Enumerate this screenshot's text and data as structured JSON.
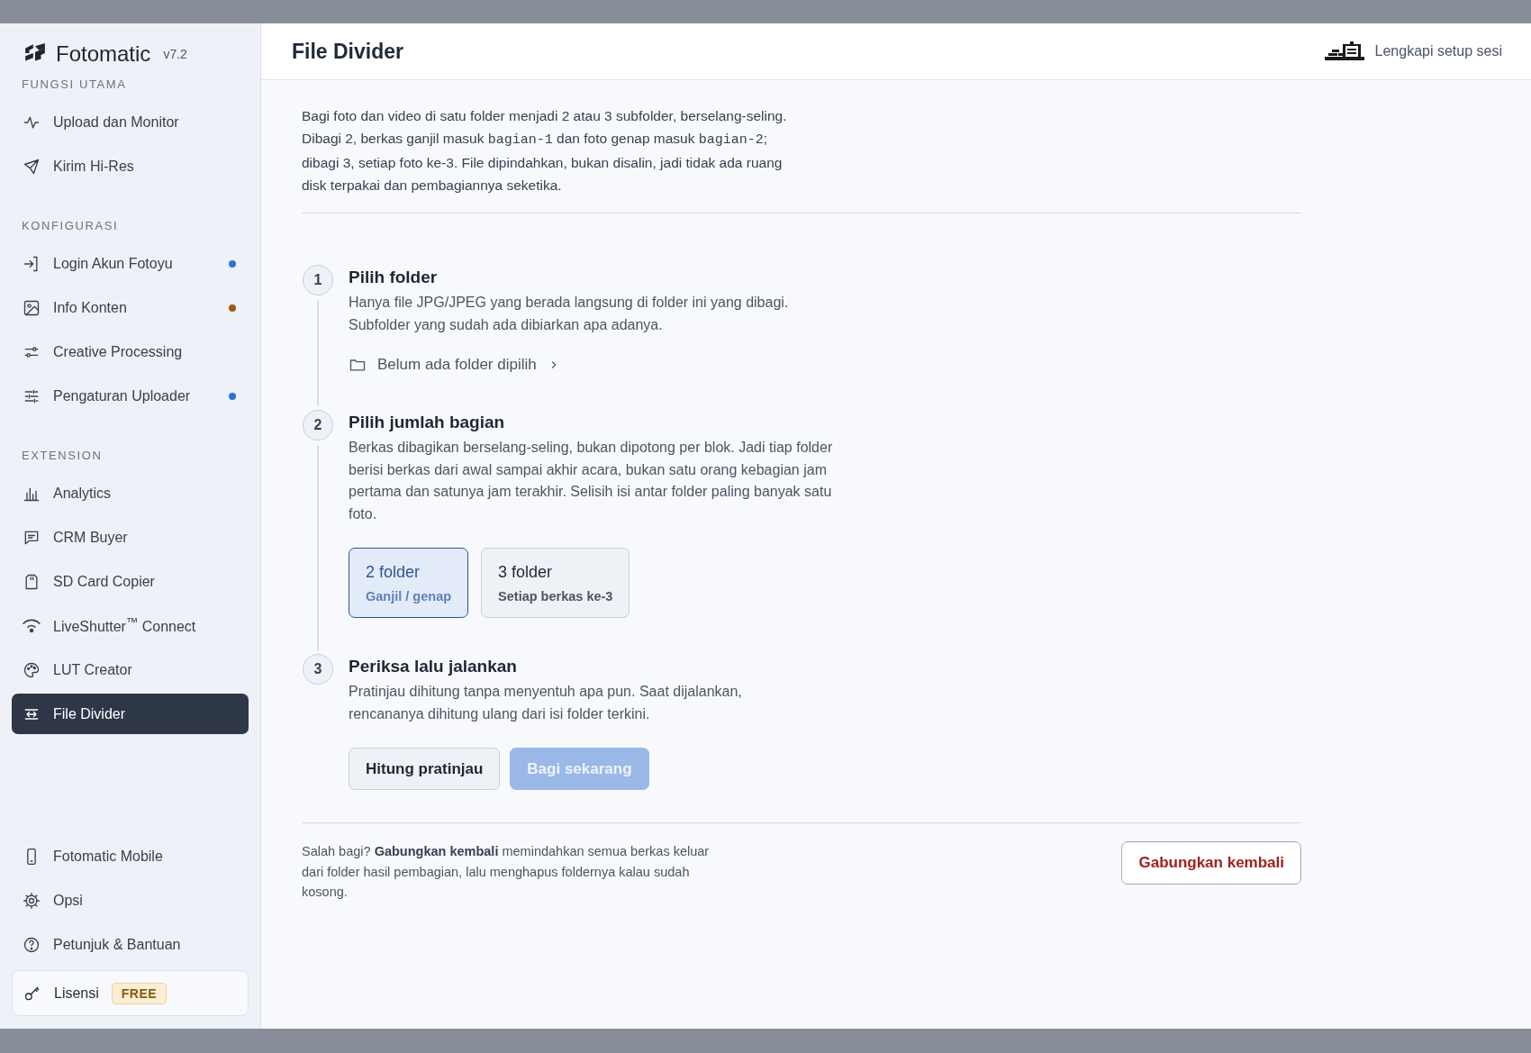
{
  "sidebar": {
    "logo": {
      "name": "Fotomatic",
      "version": "v7.2"
    },
    "sections": [
      {
        "heading": "FUNGSI UTAMA",
        "items": [
          {
            "label": "Upload dan Monitor",
            "selected": false
          },
          {
            "label": "Kirim Hi-Res",
            "selected": false
          }
        ]
      },
      {
        "heading": "KONFIGURASI",
        "items": [
          {
            "label": "Login Akun Fotoyu",
            "selected": false,
            "color": "#2f6fd8"
          },
          {
            "label": "Info Konten",
            "selected": false,
            "color": "#9a5b12"
          },
          {
            "label": "Creative Processing",
            "selected": false
          },
          {
            "label": "Pengaturan Uploader",
            "selected": false,
            "color": "#2f6fd8"
          }
        ]
      },
      {
        "heading": "EXTENSION",
        "items": [
          {
            "label": "Analytics",
            "selected": false
          },
          {
            "label": "CRM Buyer",
            "selected": false
          },
          {
            "label": "SD Card Copier",
            "selected": false
          },
          {
            "label": "LiveShutter$^{™}$ Connect",
            "selected": false
          },
          {
            "label": "LUT Creator",
            "selected": false
          },
          {
            "label": "File Divider",
            "selected": true
          }
        ]
      }
    ],
    "footer_items": [
      {
        "label": "Fotomatic Mobile",
        "selected": false
      },
      {
        "label": "Opsi",
        "selected": false
      },
      {
        "label": "Petunjuk & Bantuan",
        "selected": false
      }
    ],
    "license": {
      "label": "Lisensi",
      "badge": "FREE"
    }
  },
  "header": {
    "title": "File Divider",
    "action": "Lengkapi setup sesi"
  },
  "intro": [
    {
      "text": "Bagi foto dan video di satu folder menjadi 2 atau 3 subfolder, berselang-seling. Dibagi 2, berkas ganjil masuk ",
      "code": false
    },
    {
      "text": "bagian-1",
      "code": true
    },
    {
      "text": " dan foto genap masuk ",
      "code": false
    },
    {
      "text": "bagian-2",
      "code": true
    },
    {
      "text": "; dibagi 3, setiap foto ke-3. File dipindahkan, bukan disalin, jadi tidak ada ruang disk terpakai dan pembagiannya seketika.",
      "code": false
    }
  ],
  "steps": [
    {
      "number": "1",
      "title": "Pilih folder",
      "description": "Hanya file JPG/JPEG yang berada langsung di folder ini yang dibagi. Subfolder yang sudah ada dibiarkan apa adanya.",
      "kind": "folder",
      "folder": "Belum ada folder dipilih"
    },
    {
      "number": "2",
      "title": "Pilih jumlah bagian",
      "description": "Berkas dibagikan berselang-seling, bukan dipotong per blok. Jadi tiap folder berisi berkas dari awal sampai akhir acara, bukan satu orang kebagian jam pertama dan satunya jam terakhir. Selisih isi antar folder paling banyak satu foto.",
      "kind": "options",
      "options": [
        {
          "title": "2 folder",
          "subtitle": "Ganjil / genap",
          "selected": true
        },
        {
          "title": "3 folder",
          "subtitle": "Setiap berkas ke-3",
          "selected": false
        }
      ]
    },
    {
      "number": "3",
      "title": "Periksa lalu jalankan",
      "description": "Pratinjau dihitung tanpa menyentuh apa pun. Saat dijalankan, rencananya dihitung ulang dari isi folder terkini.",
      "kind": "buttons",
      "buttons": [
        {
          "label": "Hitung pratinjau",
          "kind": "secondary",
          "disabled": false
        },
        {
          "label": "Bagi sekarang",
          "kind": "primary",
          "disabled": true
        }
      ]
    }
  ],
  "footer": {
    "note": "Salah bagi? **Gabungkan kembali** memindahkan semua berkas keluar dari folder hasil pembagian, lalu menghapus foldernya kalau sudah kosong.",
    "button": "Gabungkan kembali"
  }
}
